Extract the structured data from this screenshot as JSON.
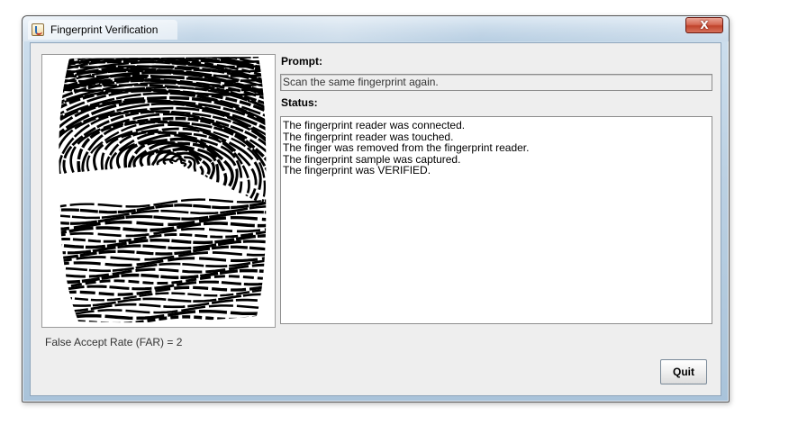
{
  "window": {
    "title": "Fingerprint Verification",
    "close_label": "X",
    "app_icon": "java-coffee-icon"
  },
  "fingerprint": {
    "image": "fingerprint-scan-image"
  },
  "prompt": {
    "label": "Prompt:",
    "value": "Scan the same fingerprint again."
  },
  "status": {
    "label": "Status:",
    "lines": [
      "The fingerprint reader was connected.",
      "The fingerprint reader was touched.",
      "The finger was removed from the fingerprint reader.",
      "The fingerprint sample was captured.",
      "The fingerprint was VERIFIED."
    ]
  },
  "far": {
    "text": "False Accept Rate (FAR) = 2"
  },
  "buttons": {
    "quit_label": "Quit"
  },
  "colors": {
    "close_button": "#c0442c",
    "client_background": "#eeeeee"
  }
}
